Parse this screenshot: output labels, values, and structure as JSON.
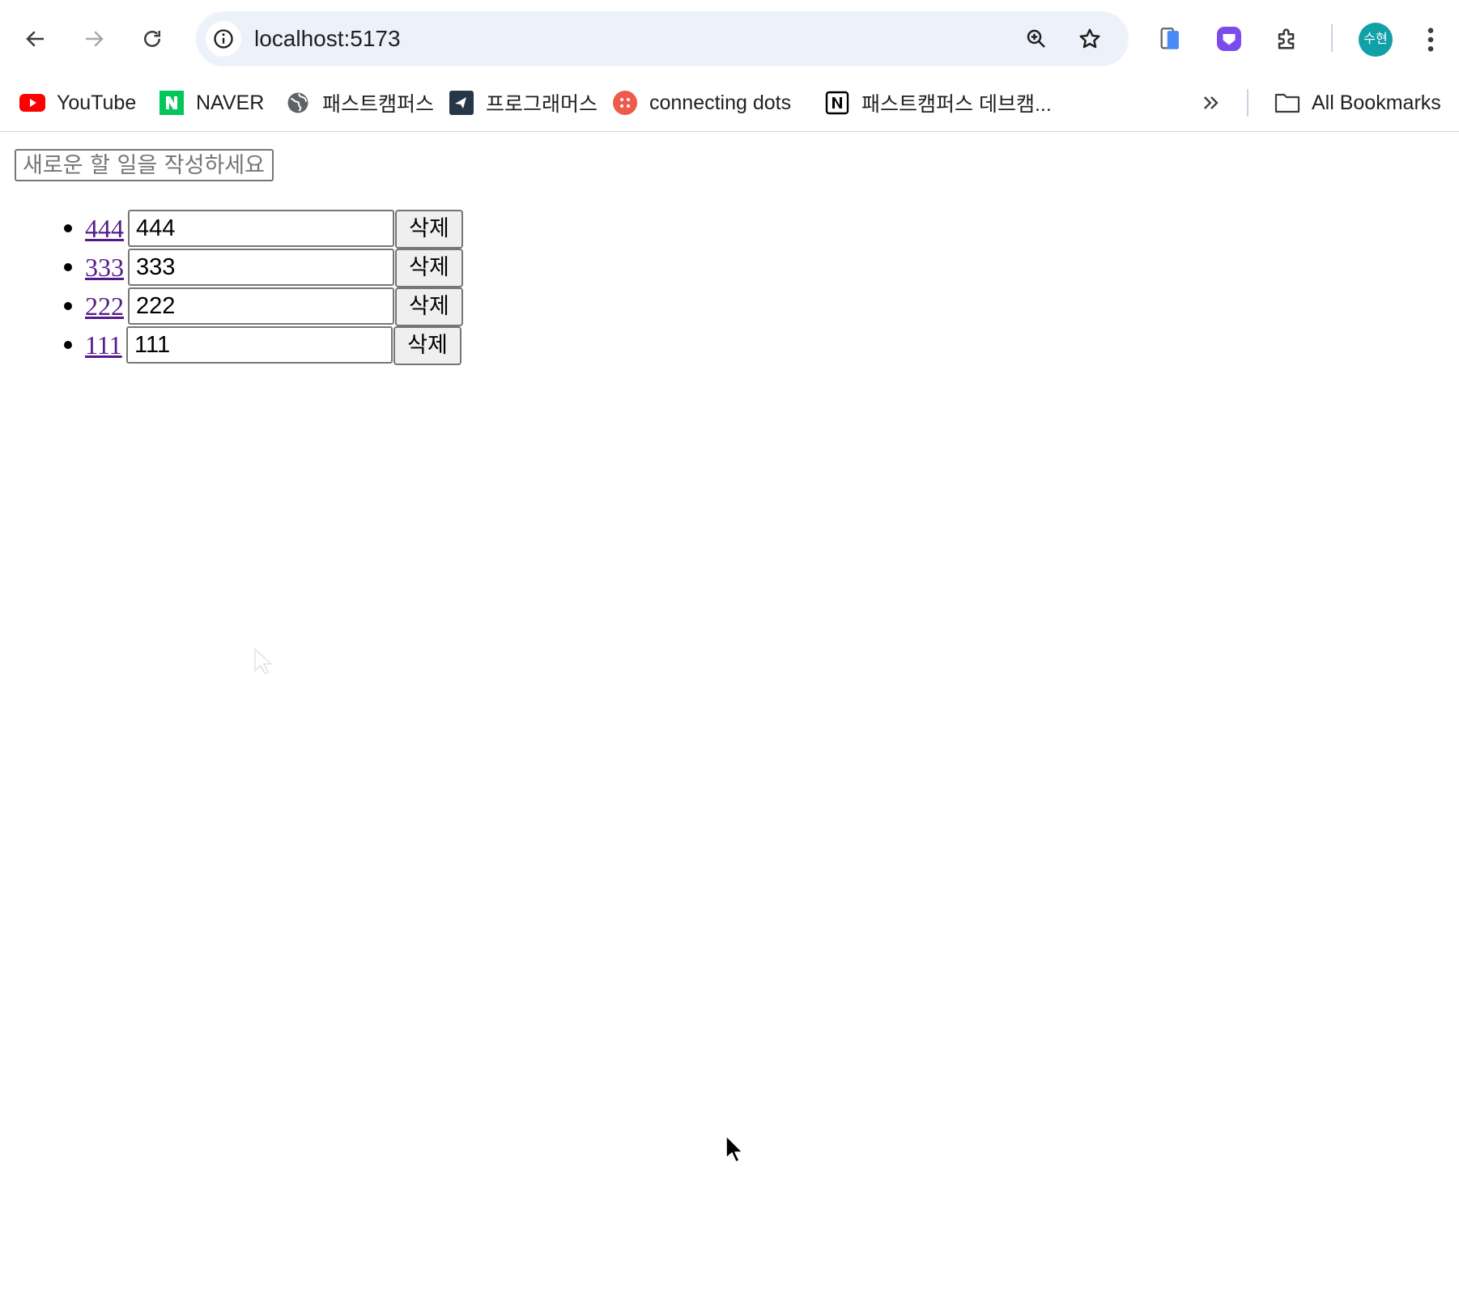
{
  "browser": {
    "url": "localhost:5173",
    "profile_initials": "수현",
    "icons": {
      "back": "arrow-left-icon",
      "forward": "arrow-right-icon",
      "reload": "reload-icon",
      "info": "info-icon",
      "zoom": "zoom-in-icon",
      "bookmark": "star-icon",
      "menu": "kebab-menu-icon"
    }
  },
  "bookmarks": {
    "items": [
      {
        "label": "YouTube",
        "icon": "youtube-icon"
      },
      {
        "label": "NAVER",
        "icon": "naver-icon"
      },
      {
        "label": "패스트캠퍼스",
        "icon": "globe-icon"
      },
      {
        "label": "프로그래머스",
        "icon": "programmers-icon"
      },
      {
        "label": "connecting dots",
        "icon": "connecting-dots-icon"
      },
      {
        "label": "패스트캠퍼스 데브캠...",
        "icon": "notion-icon"
      }
    ],
    "all_bookmarks_label": "All Bookmarks"
  },
  "todo": {
    "new_placeholder": "새로운 할 일을 작성하세요",
    "delete_label": "삭제",
    "items": [
      {
        "link": "444",
        "edit_value": "444"
      },
      {
        "link": "333",
        "edit_value": "333"
      },
      {
        "link": "222",
        "edit_value": "222"
      },
      {
        "link": "111",
        "edit_value": "111"
      }
    ]
  }
}
